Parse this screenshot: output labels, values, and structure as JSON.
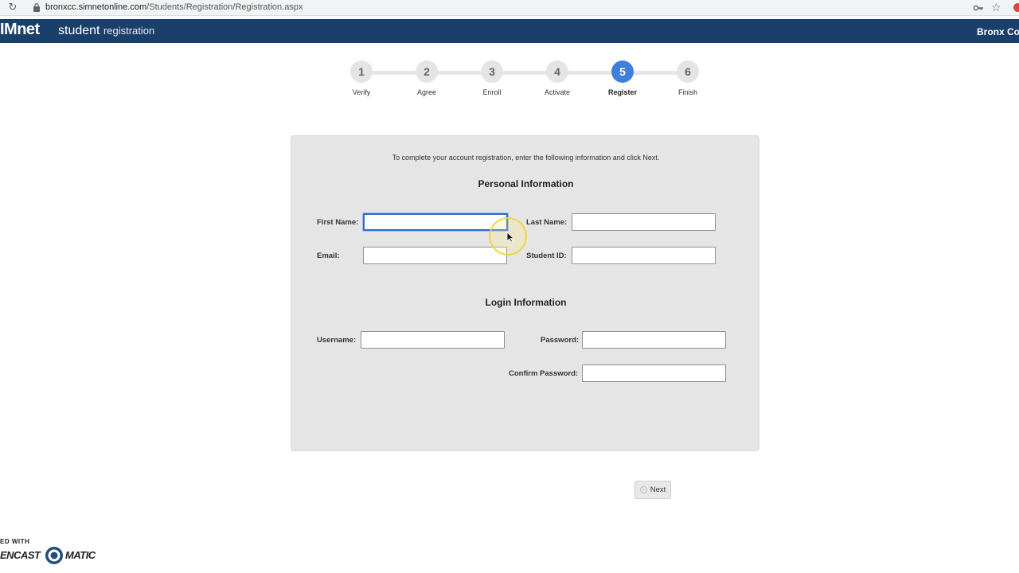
{
  "browser": {
    "url_host": "bronxcc.simnetonline.com",
    "url_path": "/Students/Registration/Registration.aspx"
  },
  "header": {
    "logo": "IMnet",
    "app_name_bold": "student",
    "app_name_light": "registration",
    "school_name": "Bronx Con"
  },
  "stepper": {
    "steps": [
      {
        "number": "1",
        "label": "Verify"
      },
      {
        "number": "2",
        "label": "Agree"
      },
      {
        "number": "3",
        "label": "Enroll"
      },
      {
        "number": "4",
        "label": "Activate"
      },
      {
        "number": "5",
        "label": "Register"
      },
      {
        "number": "6",
        "label": "Finish"
      }
    ],
    "active_step": 5
  },
  "form": {
    "instructions": "To complete your account registration, enter the following information and click Next.",
    "personal_title": "Personal Information",
    "login_title": "Login Information",
    "first_name_label": "First Name:",
    "first_name_value": "",
    "last_name_label": "Last Name:",
    "last_name_value": "",
    "email_label": "Email:",
    "email_value": "",
    "student_id_label": "Student ID:",
    "student_id_value": "",
    "username_label": "Username:",
    "username_value": "",
    "password_label": "Password:",
    "password_value": "",
    "confirm_password_label": "Confirm Password:",
    "confirm_password_value": ""
  },
  "actions": {
    "next_label": "Next"
  },
  "watermark": {
    "top": "ED WITH",
    "left": "ENCAST",
    "right": "MATIC"
  },
  "colors": {
    "header_bg": "#1b3f6b",
    "active_step": "#3f80d8",
    "panel_bg": "#e5e5e5",
    "focus_border": "#2e6ad1"
  }
}
